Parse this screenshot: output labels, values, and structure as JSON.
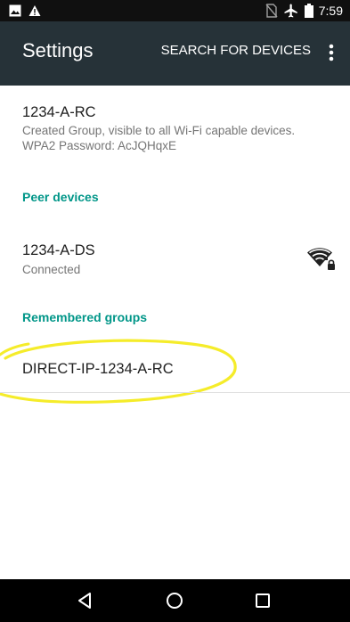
{
  "status_bar": {
    "time": "7:59",
    "left_icons": [
      "image-icon",
      "warning-icon"
    ],
    "right_icons": [
      "no-sim-icon",
      "airplane-mode-icon",
      "battery-icon"
    ]
  },
  "app_bar": {
    "title": "Settings",
    "action_label": "SEARCH FOR DEVICES",
    "menu_icon": "more-vert-icon",
    "background_color": "#263238"
  },
  "my_device": {
    "name": "1234-A-RC",
    "status": "Created Group, visible to all Wi-Fi capable devices.",
    "password": "WPA2 Password: AcJQHqxE"
  },
  "peer_devices": {
    "header": "Peer devices",
    "items": [
      {
        "name": "1234-A-DS",
        "status": "Connected",
        "icon": "wifi-lock-icon"
      }
    ]
  },
  "remembered_groups": {
    "header": "Remembered groups",
    "items": [
      {
        "name": "DIRECT-IP-1234-A-RC"
      }
    ]
  },
  "nav_bar": {
    "buttons": [
      "back-icon",
      "home-icon",
      "recents-icon"
    ]
  },
  "colors": {
    "accent": "#009688",
    "highlight": "#f5ec2a",
    "status_bar": "#101010"
  }
}
